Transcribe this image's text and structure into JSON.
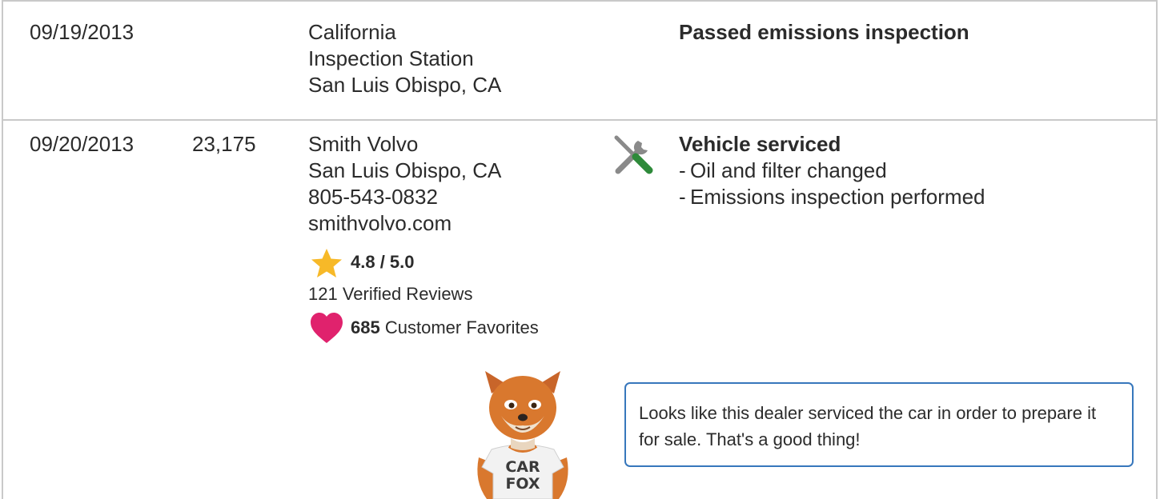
{
  "rows": [
    {
      "date": "09/19/2013",
      "mileage": "",
      "source_lines": [
        "California",
        "Inspection Station",
        "San Luis Obispo, CA"
      ],
      "comment_title": "Passed emissions inspection"
    },
    {
      "date": "09/20/2013",
      "mileage": "23,175",
      "source_lines": [
        "Smith Volvo",
        "San Luis Obispo, CA",
        "805-543-0832",
        "smithvolvo.com"
      ],
      "rating": "4.8 / 5.0",
      "reviews": "121 Verified Reviews",
      "favorites_count": "685",
      "favorites_label": "Customer Favorites",
      "comment_icon": "wrench-screwdriver-icon",
      "comment_title": "Vehicle serviced",
      "comment_items": [
        "Oil and filter changed",
        "Emissions inspection performed"
      ]
    }
  ],
  "mascot": {
    "shirt_line1": "CAR",
    "shirt_line2": "FOX"
  },
  "tip": "Looks like this dealer serviced the car in order to prepare it for sale. That's a good thing!",
  "colors": {
    "border": "#c9c9c9",
    "star": "#f7b928",
    "heart": "#e0226d",
    "tip_border": "#3777bc",
    "screwdriver": "#2e8a3a"
  }
}
